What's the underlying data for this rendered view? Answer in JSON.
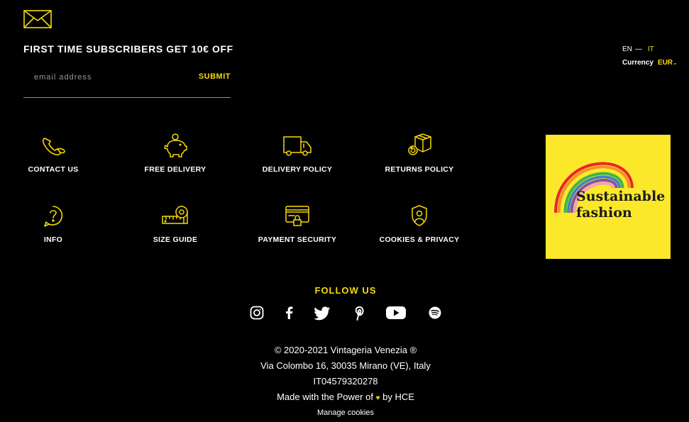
{
  "newsletter": {
    "title": "FIRST TIME SUBSCRIBERS GET 10€ OFF",
    "email_placeholder": "email address",
    "submit_label": "SUBMIT"
  },
  "locale": {
    "lang_en": "EN",
    "lang_separator": "—",
    "lang_it": "IT",
    "currency_label": "Currency",
    "currency_value": "EUR",
    "currency_chevron": "⌄"
  },
  "services": [
    {
      "label": "CONTACT US",
      "icon": "phone-icon"
    },
    {
      "label": "FREE DELIVERY",
      "icon": "piggy-bank-icon"
    },
    {
      "label": "DELIVERY POLICY",
      "icon": "delivery-truck-icon"
    },
    {
      "label": "RETURNS POLICY",
      "icon": "return-box-icon"
    },
    {
      "label": "INFO",
      "icon": "question-icon"
    },
    {
      "label": "SIZE GUIDE",
      "icon": "measuring-tape-icon"
    },
    {
      "label": "PAYMENT SECURITY",
      "icon": "secure-card-icon"
    },
    {
      "label": "COOKIES & PRIVACY",
      "icon": "privacy-shield-icon"
    }
  ],
  "badge": {
    "line1": "Sustainable",
    "line2": "fashion"
  },
  "follow": {
    "title": "FOLLOW US",
    "networks": [
      "instagram",
      "facebook",
      "twitter",
      "pinterest",
      "youtube",
      "spotify"
    ]
  },
  "footer": {
    "copyright": "© 2020-2021 Vintageria Venezia ®",
    "address": "Via Colombo 16, 30035 Mirano (VE), Italy",
    "vat": "IT04579320278",
    "made_prefix": "Made with the Power of",
    "made_suffix": "by HCE",
    "manage_cookies": "Manage cookies"
  },
  "colors": {
    "background": "#000000",
    "accent": "#f5d90a",
    "badge_bg": "#fce82a"
  }
}
